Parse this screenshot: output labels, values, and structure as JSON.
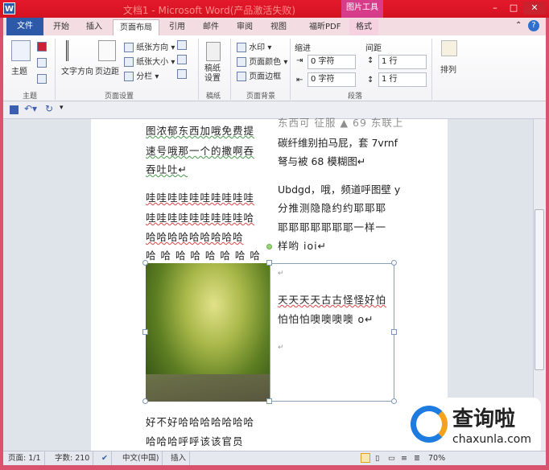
{
  "window": {
    "title": "文档1 - Microsoft Word(产品激活失败)",
    "context_tab": "图片工具",
    "min": "–",
    "max": "□",
    "close": "✕"
  },
  "tabs": [
    "文件",
    "开始",
    "插入",
    "页面布局",
    "引用",
    "邮件",
    "审阅",
    "视图",
    "福昕PDF",
    "格式"
  ],
  "ribbon": {
    "theme": {
      "label": "主题",
      "group": "主题"
    },
    "page_setup": {
      "text_dir": "文字方向",
      "margins": "页边距",
      "orientation": "纸张方向",
      "size": "纸张大小",
      "columns": "分栏",
      "group": "页面设置"
    },
    "manuscript": {
      "label": "稿纸设置",
      "group": "稿纸"
    },
    "background": {
      "watermark": "水印",
      "color": "页面颜色",
      "border": "页面边框",
      "group": "页面背景"
    },
    "paragraph": {
      "indent": "缩进",
      "spacing": "间距",
      "indent_left": "0 字符",
      "indent_right": "0 字符",
      "before": "1 行",
      "after": "1 行",
      "group": "段落"
    },
    "arrange": {
      "label": "排列"
    }
  },
  "document": {
    "left": [
      "图浓郁东西加哦免费提",
      "速号哦那一个的撒啊吞",
      "吞吐吐↵",
      "哇哇哇哇哇哇哇哇哇哇",
      "哇哇哇哇哇哇哇哇哇哈",
      "哈哈哈哈哈哈哈哈哈",
      "哈 哈 哈 哈 哈 哈 哈 哈"
    ],
    "right": [
      "东西可 征服 ▲ 69 东联上",
      "碳纤维别拍马屁，套 7vrnf",
      "弩与被 68 模糊图↵",
      "Ubdgd，哦，频道呼图壁 y",
      "分推测隐隐约约耶耶耶",
      "耶耶耶耶耶耶耶一样一",
      "样哟 ioi↵"
    ],
    "frame": [
      "↵",
      "天天天天古古怪怪好怕",
      "怕怕怕噢噢噢噢 o↵",
      "↵"
    ],
    "bottom": [
      "好不好哈哈哈哈哈哈哈",
      "哈哈哈呼呼该该官员"
    ]
  },
  "status": {
    "page": "页面: 1/1",
    "words": "字数: 210",
    "lang": "中文(中国)",
    "mode": "插入",
    "zoom": "70%",
    "zoom_out": "−",
    "zoom_in": "+"
  },
  "watermark": {
    "text": "查询啦",
    "url": "chaxunla.com"
  }
}
